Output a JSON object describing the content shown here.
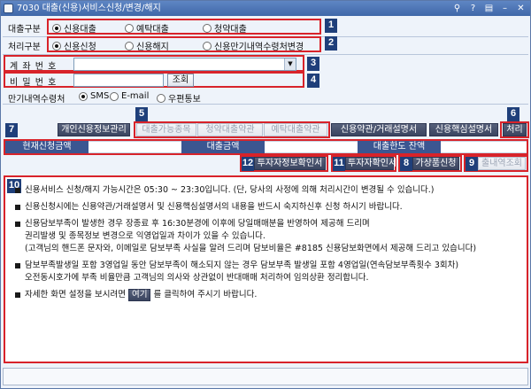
{
  "window": {
    "title": "7030 대출(신용)서비스신청/변경/해지",
    "controls": [
      "⚲",
      "?",
      "▤",
      "–",
      "✕"
    ]
  },
  "loan_type": {
    "label": "대출구분",
    "options": [
      "신용대출",
      "예탁대출",
      "청약대출"
    ],
    "selected": 0,
    "badge": "1"
  },
  "process_type": {
    "label": "처리구분",
    "options": [
      "신용신청",
      "신용해지",
      "신용만기내역수령처변경"
    ],
    "selected": 0,
    "badge": "2"
  },
  "account": {
    "label": "계 좌 번 호",
    "value": "",
    "badge": "3"
  },
  "password": {
    "label": "비 밀 번 호",
    "value": "",
    "query_label": "조회",
    "badge": "4"
  },
  "maturity": {
    "label": "만기내역수령처",
    "options": [
      "SMS",
      "E-mail",
      "우편통보"
    ],
    "selected": 0
  },
  "buttons_row": {
    "personal_info": "개인신용정보관리",
    "loanable_items": "대출가능종목",
    "subscription_terms": "청약대출약관",
    "deposit_terms": "예탁대출약관",
    "credit_terms": "신용약관/거래설명서",
    "core_explanation": "신용핵심설명서",
    "process": "처리",
    "badge5": "5",
    "badge6": "6",
    "badge7": "7"
  },
  "summary": {
    "current_amount_label": "현재신청금액",
    "current_amount_value": "",
    "loan_amount_label": "대출금액",
    "loan_amount_value": "",
    "limit_balance_label": "대출한도 잔액",
    "limit_balance_value": ""
  },
  "confirm_buttons": {
    "investor_info": "투자자정보확인서",
    "investor_confirm": "투자자확인서",
    "join_product": "가상품신청",
    "history_query": "출내역조회",
    "badge12": "12",
    "badge11": "11",
    "badge8": "8",
    "badge9": "9"
  },
  "notice": {
    "badge": "10",
    "items": [
      "신용서비스 신청/해지 가능시간은 05:30 ~ 23:30입니다. (단, 당사의 사정에 의해 처리시간이 변경될 수 있습니다.)",
      "신용신청시에는 신용약관/거래설명서 및 신용핵심설명서의 내용을 반드시 숙지하신후 신청 하시기 바랍니다.",
      "신용담보부족이 발생한 경우 장종료 후 16:30분경에 이후에 당일매매분을 반영하여 제공해 드리며",
      "담보부족발생일 포함 3영업일 동안 담보부족이 해소되지 않는 경우 담보부족 발생일 포함 4영업일(연속담보부족횟수 3회차)",
      "자세한 화면 설정을 보시려면"
    ],
    "item3_line2": "권리발생 및 종목정보 변경으로 익영업일과 차이가 있을 수 있습니다.",
    "item3_line3": "(고객님의 핸드폰 문자와, 이메일로 담보부족 사실을 알려 드리며 담보비율은 #8185 신용담보화면에서 제공해 드리고 있습니다)",
    "item4_line2": "오전동시호가에 부족 비율만큼 고객님의 의사와 상관없이 반대매매 처리하여 임의상환 정리합니다.",
    "item5_button": "여기",
    "item5_tail": "를 클릭하여 주시기 바랍니다."
  }
}
